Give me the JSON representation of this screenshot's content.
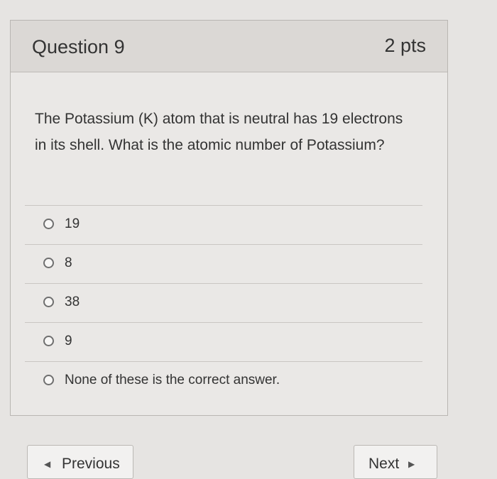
{
  "question": {
    "title": "Question 9",
    "points": "2 pts",
    "text": "The Potassium (K) atom that is neutral has 19 electrons in its shell. What is the atomic number of Potassium?"
  },
  "answers": [
    {
      "label": "19"
    },
    {
      "label": "8"
    },
    {
      "label": "38"
    },
    {
      "label": "9"
    },
    {
      "label": "None of these is the correct answer."
    }
  ],
  "nav": {
    "previous_label": "Previous",
    "next_label": "Next",
    "previous_icon": "triangle-left-icon",
    "next_icon": "triangle-right-icon"
  }
}
